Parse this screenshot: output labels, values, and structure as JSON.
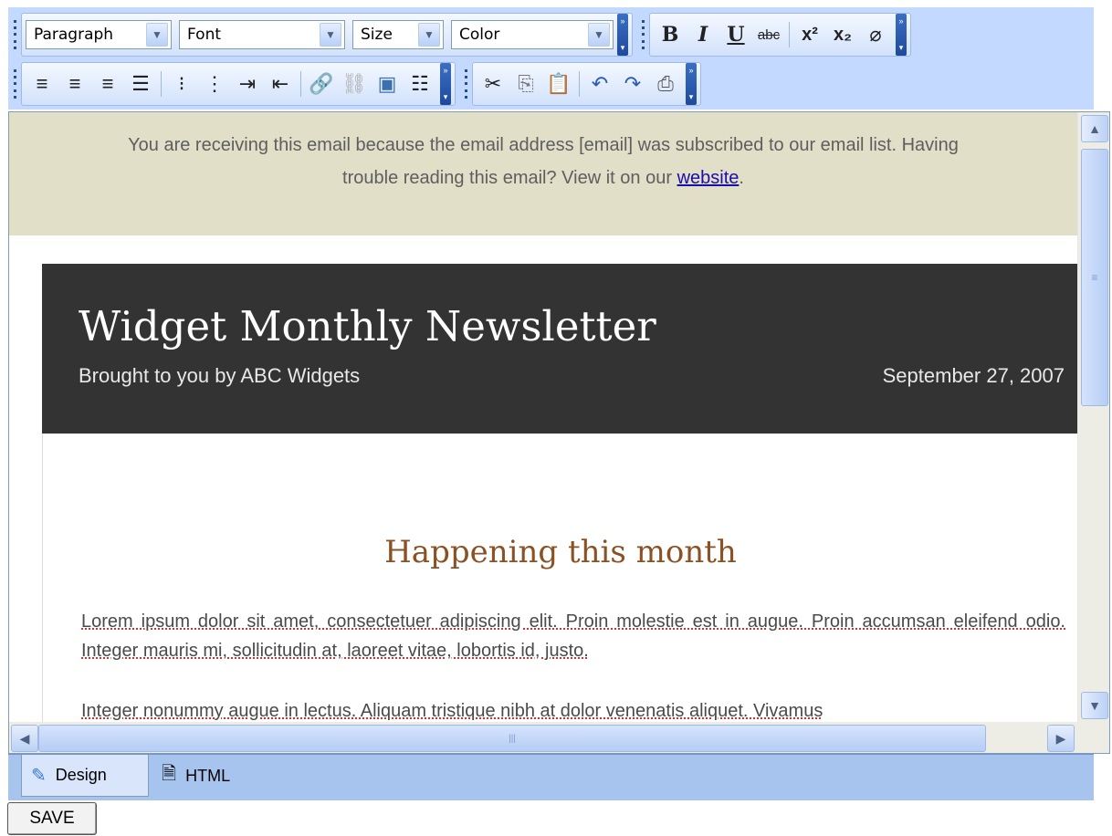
{
  "toolbar": {
    "row1": {
      "paragraph": "Paragraph",
      "font": "Font",
      "size": "Size",
      "color": "Color",
      "buttons": {
        "bold": "B",
        "italic": "I",
        "underline": "U",
        "strike": "abc",
        "superscript": "x²",
        "subscript": "x₂",
        "eraser": "⌫"
      }
    },
    "row2": {
      "icons": [
        "align-left",
        "align-right",
        "align-center",
        "justify",
        "bulleted-list",
        "numbered-list",
        "indent",
        "outdent",
        "insert-link",
        "remove-link",
        "insert-image",
        "horizontal-rule",
        "cut",
        "copy",
        "paste",
        "undo",
        "redo",
        "print"
      ]
    }
  },
  "editor": {
    "notice_line1": "You are receiving this email because the email address [email] was subscribed to our email list. Having",
    "notice_line2_prefix": "trouble reading this email? View it on our",
    "notice_link": "website",
    "notice_line2_suffix": ".",
    "newsletter_title": "Widget Monthly Newsletter",
    "newsletter_subtitle": "Brought to you by ABC Widgets",
    "newsletter_date": "September 27, 2007",
    "section_title": "Happening this month",
    "para1": "Lorem ipsum dolor sit amet, consectetuer adipiscing elit. Proin molestie est in augue. Proin accumsan eleifend odio. Integer mauris mi, sollicitudin at, laoreet vitae, lobortis id, justo.",
    "para2": "Integer nonummy augue in lectus. Aliquam tristique nibh at dolor venenatis aliquet. Vivamus"
  },
  "tabs": {
    "design": "Design",
    "html": "HTML"
  },
  "save_label": "SAVE",
  "colors": {
    "toolbar_bg": "#c3d9ff",
    "notice_bg": "#e2dfc8",
    "header_bg": "#333333",
    "section_title": "#8a5224",
    "tabbar_bg": "#a7c4ee"
  }
}
